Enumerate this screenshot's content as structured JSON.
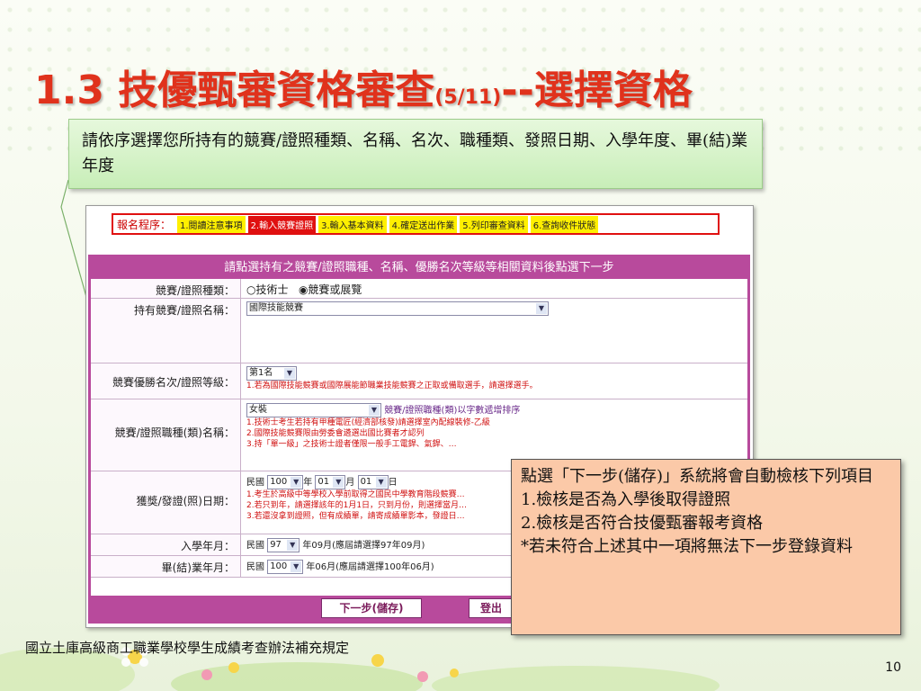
{
  "slide": {
    "title_prefix": "1.3 技優甄審資格審查",
    "title_page": "(5/11)",
    "title_suffix": "--選擇資格",
    "callout_text": "請依序選擇您所持有的競賽/證照種類、名稱、名次、職種類、發照日期、入學年度、畢(結)業年度",
    "note_lines": [
      "點選「下一步(儲存)」系統將會自動檢核下列項目",
      "1.檢核是否為入學後取得證照",
      "2.檢核是否符合技優甄審報考資格",
      "*若未符合上述其中一項將無法下一步登錄資料"
    ],
    "footer": "國立土庫高級商工職業學校學生成績考查辦法補充規定",
    "page_number": "10"
  },
  "screenshot": {
    "steps_label": "報名程序：",
    "steps": [
      "1.閱讀注意事項",
      "2.輸入競賽證照",
      "3.輸入基本資料",
      "4.確定送出作業",
      "5.列印審查資料",
      "6.查詢收件狀態"
    ],
    "form_header": "請點選持有之競賽/證照職種、名稱、優勝名次等級等相關資料後點選下一步",
    "rows": {
      "type_label": "競賽/證照種類：",
      "type_option1": "○技術士",
      "type_option2": "◉競賽或展覽",
      "name_label": "持有競賽/證照名稱：",
      "name_value": "國際技能競賽",
      "rank_label": "競賽優勝名次/證照等級：",
      "rank_value": "第1名",
      "rank_note": "1.若為國際技能競賽或國際展能節職業技能競賽之正取或備取選手，請選擇選手。",
      "job_label": "競賽/證照職種(類)名稱：",
      "job_value": "女裝",
      "job_hint": "競賽/證照職種(類)以字數遞增排序",
      "job_notes": [
        "1.技術士考生若持有甲種電匠(經濟部核發)請選擇室內配線裝修-乙級",
        "2.國際技能競賽限由勞委會遴選出國比賽者才認列",
        "3.持「單一級」之技術士證者僅限一般手工電銲、氣銲、…"
      ],
      "date_label": "獲獎/發證(照)日期：",
      "date_prefix": "民國",
      "date_year": "100",
      "date_y": "年",
      "date_month": "01",
      "date_m": "月",
      "date_day": "01",
      "date_d": "日",
      "date_notes": [
        "1.考生於高級中等學校入學前取得之國民中學教育階段競賽…",
        "2.若只到年，請選擇該年的1月1日，只到月份，則選擇當月…",
        "3.若還沒拿到證照，但有成績單，請寄成績單影本，發證日…"
      ],
      "enroll_label": "入學年月：",
      "enroll_prefix": "民國",
      "enroll_year": "97",
      "enroll_hint": "年09月(應屆請選擇97年09月)",
      "grad_label": "畢(結)業年月：",
      "grad_prefix": "民國",
      "grad_year": "100",
      "grad_hint": "年06月(應屆請選擇100年06月)"
    },
    "next_button": "下一步(儲存)",
    "logout_button": "登出"
  },
  "colors": {
    "title": "#e0321c",
    "form_border": "#b84a9c",
    "step_highlight": "#ffef00",
    "step_active": "#e01010",
    "note_bg": "#fbc9a8",
    "callout_bg": "#c8eeb8"
  }
}
